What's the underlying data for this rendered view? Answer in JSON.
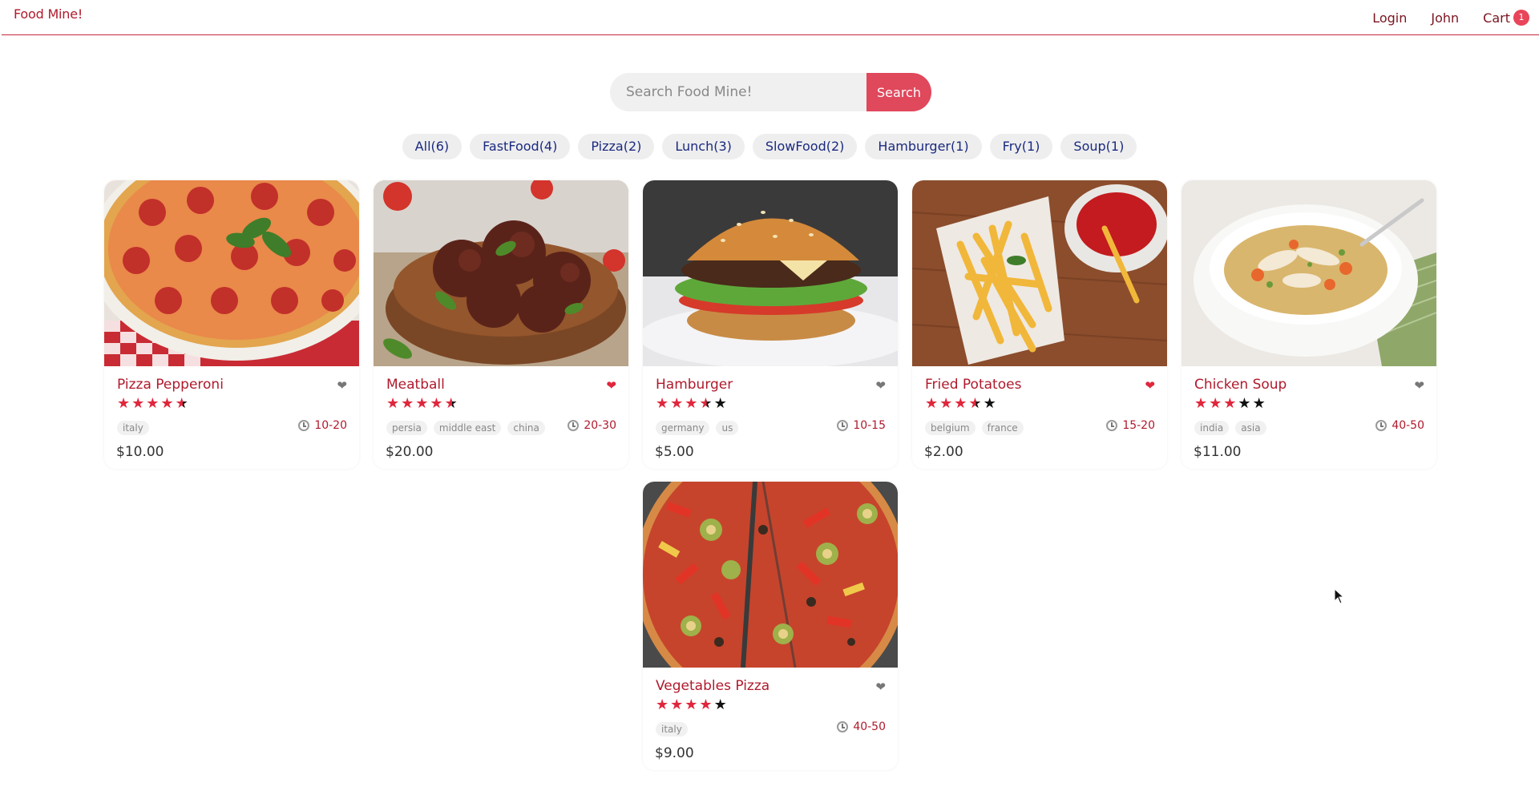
{
  "header": {
    "logo": "Food Mine!",
    "nav": {
      "login": "Login",
      "user": "John",
      "cart": "Cart",
      "cart_count": "1"
    }
  },
  "search": {
    "placeholder": "Search Food Mine!",
    "button": "Search"
  },
  "tags": [
    "All(6)",
    "FastFood(4)",
    "Pizza(2)",
    "Lunch(3)",
    "SlowFood(2)",
    "Hamburger(1)",
    "Fry(1)",
    "Soup(1)"
  ],
  "foods": [
    {
      "name": "Pizza Pepperoni",
      "favorite": false,
      "stars": 4.5,
      "origins": [
        "italy"
      ],
      "cook_time": "10-20",
      "price": "$10.00"
    },
    {
      "name": "Meatball",
      "favorite": true,
      "stars": 4.5,
      "origins": [
        "persia",
        "middle east",
        "china"
      ],
      "cook_time": "20-30",
      "price": "$20.00"
    },
    {
      "name": "Hamburger",
      "favorite": false,
      "stars": 3.5,
      "origins": [
        "germany",
        "us"
      ],
      "cook_time": "10-15",
      "price": "$5.00"
    },
    {
      "name": "Fried Potatoes",
      "favorite": true,
      "stars": 3.5,
      "origins": [
        "belgium",
        "france"
      ],
      "cook_time": "15-20",
      "price": "$2.00"
    },
    {
      "name": "Chicken Soup",
      "favorite": false,
      "stars": 3,
      "origins": [
        "india",
        "asia"
      ],
      "cook_time": "40-50",
      "price": "$11.00"
    },
    {
      "name": "Vegetables Pizza",
      "favorite": false,
      "stars": 4,
      "origins": [
        "italy"
      ],
      "cook_time": "40-50",
      "price": "$9.00"
    }
  ],
  "colors": {
    "brand": "#b01a2c",
    "accent": "#e0485c",
    "tag_text": "#1b2a80"
  }
}
